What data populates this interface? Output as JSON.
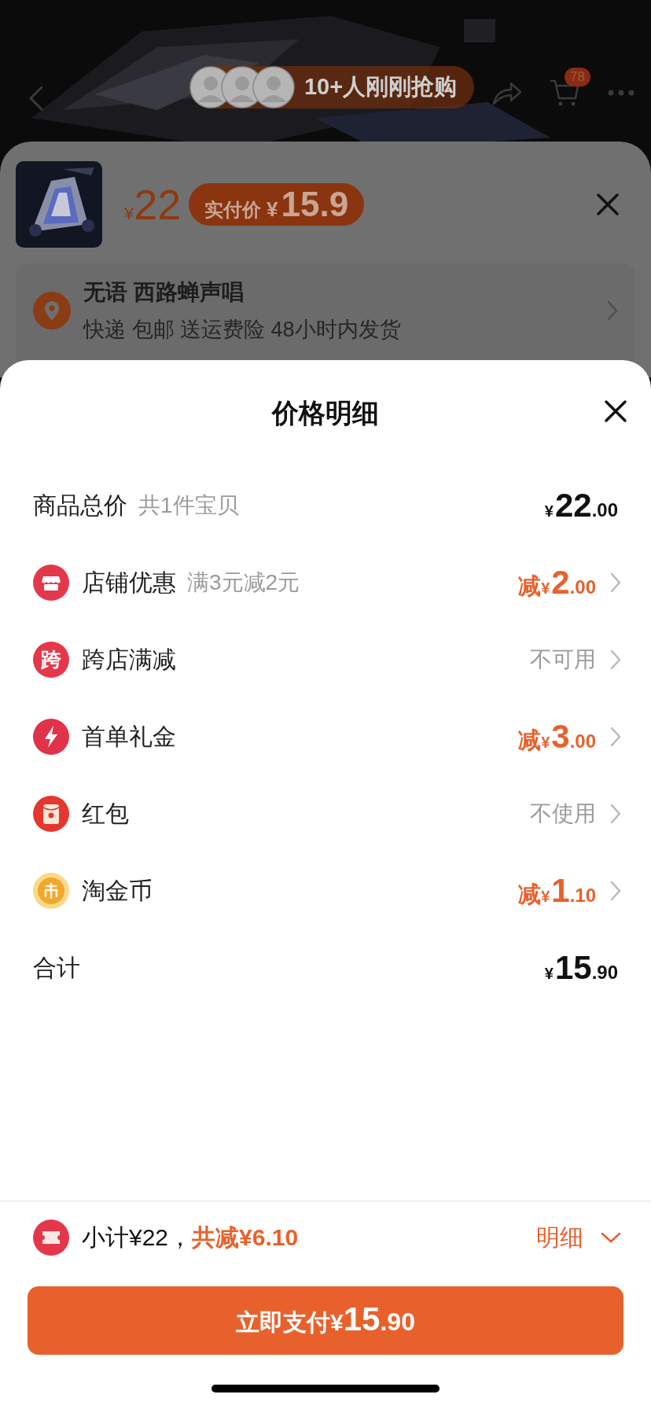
{
  "header": {
    "buyers_text": "10+人刚刚抢购",
    "cart_count": "78"
  },
  "product_sheet": {
    "price": "¥22",
    "pay_badge": "实付价 ¥15.9",
    "address": {
      "name": "无语 西路蝉声唱",
      "shipping": "快递 包邮 送运费险 48小时内发货"
    }
  },
  "detail": {
    "title": "价格明细",
    "rows": [
      {
        "kind": "total",
        "label": "商品总价",
        "note": "共1件宝贝",
        "value": "¥22.00"
      },
      {
        "kind": "discount",
        "label": "店铺优惠",
        "note": "满3元减2元",
        "value": "减¥2.00"
      },
      {
        "kind": "status",
        "icon_text": "跨",
        "label": "跨店满减",
        "value": "不可用"
      },
      {
        "kind": "discount",
        "label": "首单礼金",
        "value": "减¥3.00"
      },
      {
        "kind": "status",
        "label": "红包",
        "value": "不使用"
      },
      {
        "kind": "discount",
        "label": "淘金币",
        "value": "减¥1.10"
      },
      {
        "kind": "total",
        "label": "合计",
        "value": "¥15.90"
      }
    ]
  },
  "summary": {
    "subtotal": "小计¥22，",
    "discount": "共减¥6.10",
    "toggle": "明细"
  },
  "pay_button": "立即支付¥15.90"
}
